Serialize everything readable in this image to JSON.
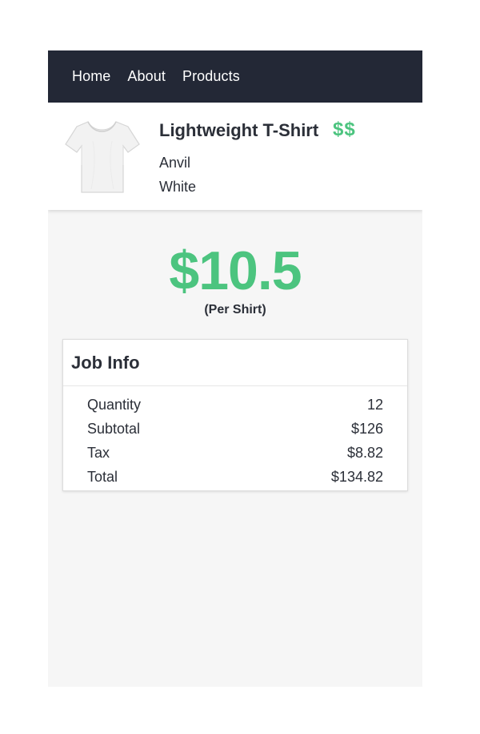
{
  "nav": {
    "items": [
      {
        "label": "Home"
      },
      {
        "label": "About"
      },
      {
        "label": "Products"
      }
    ]
  },
  "product": {
    "name": "Lightweight T-Shirt",
    "price_tier": "$$",
    "brand": "Anvil",
    "color": "White",
    "image_icon": "tshirt-icon"
  },
  "price": {
    "value": "$10.5",
    "unit": "(Per Shirt)"
  },
  "job_info": {
    "title": "Job Info",
    "rows": [
      {
        "label": "Quantity",
        "value": "12"
      },
      {
        "label": "Subtotal",
        "value": "$126"
      },
      {
        "label": "Tax",
        "value": "$8.82"
      },
      {
        "label": "Total",
        "value": "$134.82"
      }
    ]
  },
  "colors": {
    "nav_bg": "#232836",
    "accent_green": "#4cc47f",
    "page_bg": "#f6f6f6",
    "text": "#2b2f38"
  }
}
